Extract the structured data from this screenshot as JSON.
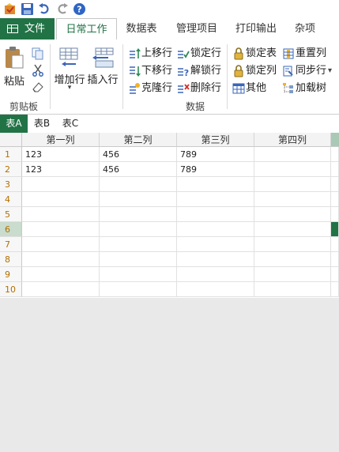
{
  "ribbon_tabs": {
    "file": "文件",
    "daily": "日常工作",
    "datasheet": "数据表",
    "manage": "管理项目",
    "print": "打印输出",
    "misc": "杂项"
  },
  "clipboard": {
    "paste": "粘贴",
    "group_label": "剪贴板"
  },
  "data_group": {
    "add_row": "增加行",
    "insert_row": "插入行",
    "move_up": "上移行",
    "move_down": "下移行",
    "clone_row": "克隆行",
    "lock_row": "锁定行",
    "unlock_row": "解锁行",
    "delete_row": "删除行",
    "lock_table": "锁定表",
    "lock_col": "锁定列",
    "other": "其他",
    "reset_col": "重置列",
    "sync_row": "同步行",
    "load_tree": "加载树",
    "group_label": "数据"
  },
  "sheet_tabs": [
    "表A",
    "表B",
    "表C"
  ],
  "columns": [
    "第一列",
    "第二列",
    "第三列",
    "第四列"
  ],
  "rows": [
    {
      "num": "1",
      "cells": [
        "123",
        "456",
        "789",
        ""
      ]
    },
    {
      "num": "2",
      "cells": [
        "123",
        "456",
        "789",
        ""
      ]
    },
    {
      "num": "3",
      "cells": [
        "",
        "",
        "",
        ""
      ]
    },
    {
      "num": "4",
      "cells": [
        "",
        "",
        "",
        ""
      ]
    },
    {
      "num": "5",
      "cells": [
        "",
        "",
        "",
        ""
      ]
    },
    {
      "num": "6",
      "cells": [
        "",
        "",
        "",
        ""
      ]
    },
    {
      "num": "7",
      "cells": [
        "",
        "",
        "",
        ""
      ]
    },
    {
      "num": "8",
      "cells": [
        "",
        "",
        "",
        ""
      ]
    },
    {
      "num": "9",
      "cells": [
        "",
        "",
        "",
        ""
      ]
    },
    {
      "num": "10",
      "cells": [
        "",
        "",
        "",
        ""
      ]
    }
  ],
  "selected_row": "6",
  "colors": {
    "accent": "#217346",
    "row_number": "#b07000"
  }
}
